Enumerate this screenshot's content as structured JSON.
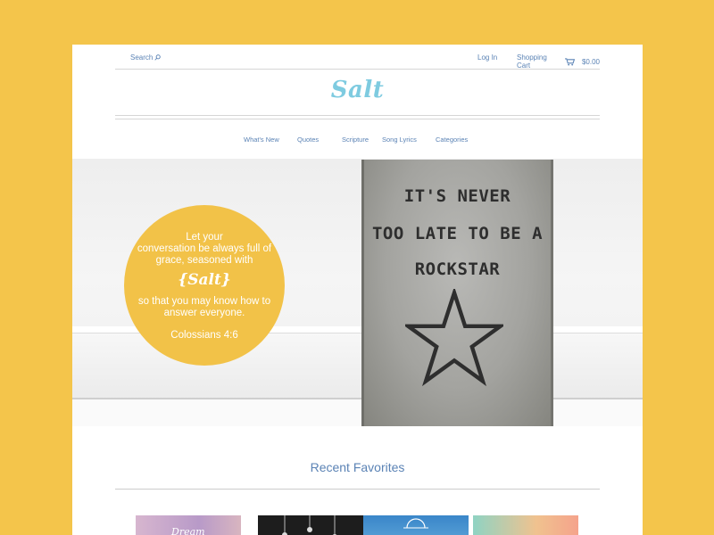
{
  "header": {
    "search_label": "Search",
    "search_icon": "magnifier",
    "login_label": "Log In",
    "cart_label": "Shopping Cart",
    "cart_icon": "cart",
    "cart_total": "$0.00"
  },
  "logo": {
    "text": "Salt",
    "color": "#7ECBE0"
  },
  "nav": [
    {
      "label": "What's New"
    },
    {
      "label": "Quotes"
    },
    {
      "label": "Scripture"
    },
    {
      "label": "Song Lyrics"
    },
    {
      "label": "Categories"
    }
  ],
  "hero": {
    "sign_lines": [
      "IT'S NEVER",
      "TOO LATE TO BE A",
      "ROCKSTAR"
    ],
    "verse_lines": [
      "Let your",
      "conversation be always full of",
      "grace, seasoned with",
      "{Salt}",
      "so that you may know how to",
      "answer everyone."
    ],
    "verse_reference": "Colossians 4:6",
    "circle_color": "#F2C248"
  },
  "recent": {
    "title": "Recent Favorites",
    "items": [
      {
        "caption": "Dream"
      },
      {
        "caption": ""
      },
      {
        "caption": ""
      },
      {
        "caption": ""
      }
    ]
  },
  "colors": {
    "background": "#F4C54B",
    "link": "#5B83B5"
  }
}
